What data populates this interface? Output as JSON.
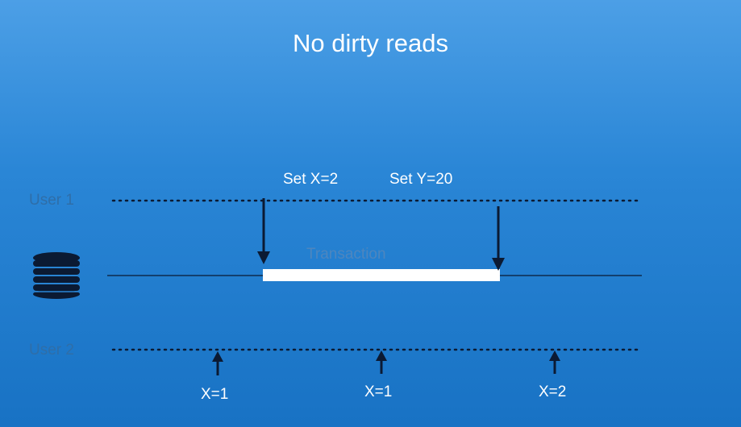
{
  "title": "No dirty reads",
  "lanes": {
    "user1": "User 1",
    "user2": "User 2"
  },
  "operations": [
    {
      "label": "Set X=2"
    },
    {
      "label": "Set Y=20"
    }
  ],
  "transaction_label": "Transaction",
  "reads": [
    {
      "label": "X=1"
    },
    {
      "label": "X=1"
    },
    {
      "label": "X=2"
    }
  ],
  "icons": {
    "database": "database-icon"
  },
  "colors": {
    "background_top": "#4c9fe6",
    "background_bottom": "#1872c4",
    "transaction_bar": "#ffffff",
    "lines": "#0b1a33"
  }
}
